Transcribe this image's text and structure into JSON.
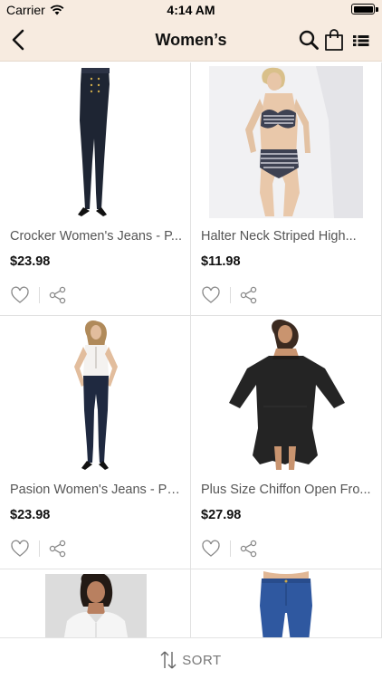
{
  "status_bar": {
    "carrier": "Carrier",
    "time": "4:14 AM"
  },
  "nav": {
    "title": "Women’s",
    "icons": [
      "back-icon",
      "search-icon",
      "shopping-bag-icon",
      "list-view-icon"
    ]
  },
  "products": [
    {
      "title": "Crocker Women's Jeans - P...",
      "price": "$23.98",
      "image": "woman in dark skinny jeans"
    },
    {
      "title": "Halter Neck Striped High...",
      "price": "$11.98",
      "image": "striped halter bikini"
    },
    {
      "title": "Pasion Women's Jeans - Pu...",
      "price": "$23.98",
      "image": "woman in white top and jeans"
    },
    {
      "title": "Plus Size Chiffon Open Fro...",
      "price": "$27.98",
      "image": "black chiffon cover-up"
    }
  ],
  "partial_products": [
    {
      "image": "woman in white blouse"
    },
    {
      "image": "blue jeans"
    }
  ],
  "card_actions": [
    "heart-icon",
    "share-icon"
  ],
  "sort_bar": {
    "label": "SORT",
    "icon": "sort-arrows-icon"
  },
  "colors": {
    "header_bg": "#f7ebe0",
    "divider": "#e1e1e1",
    "price": "#111111",
    "title": "#555555"
  }
}
